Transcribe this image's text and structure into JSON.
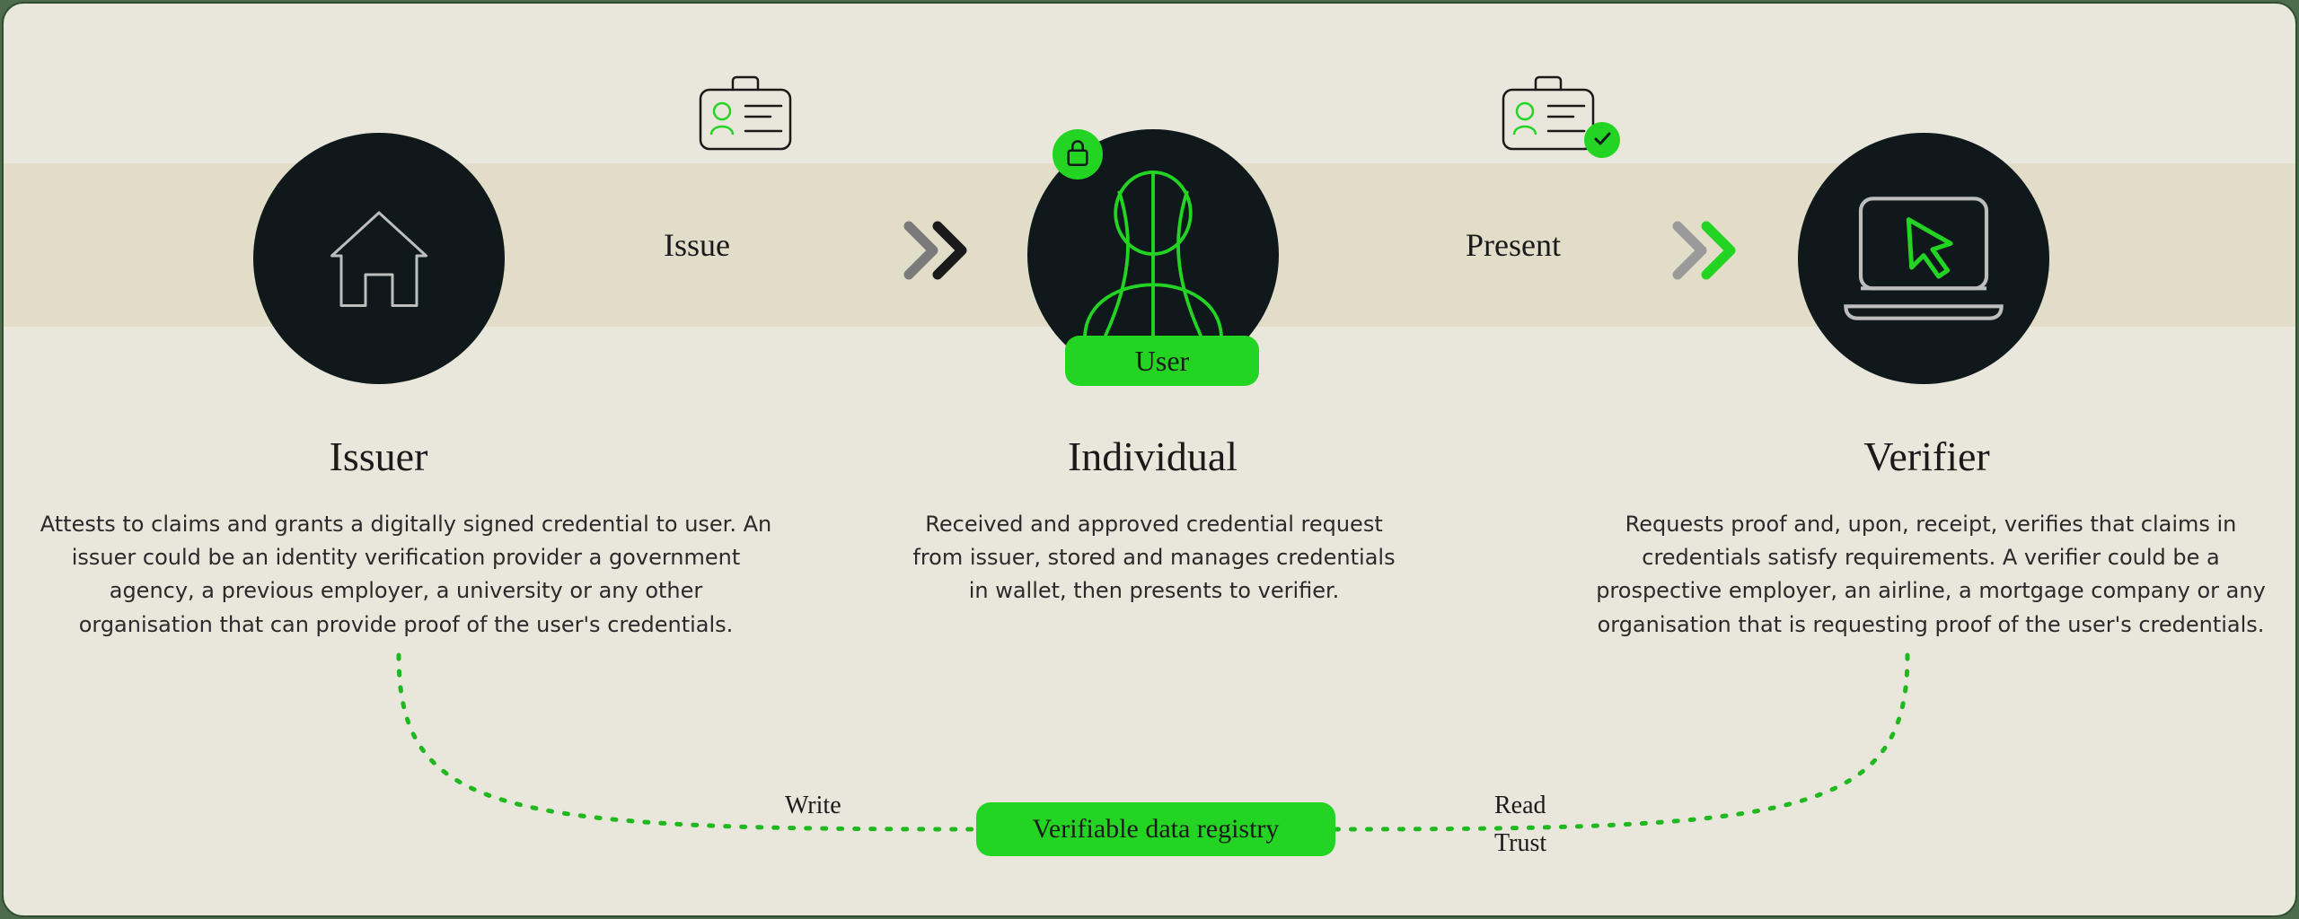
{
  "flow": {
    "issue_label": "Issue",
    "present_label": "Present"
  },
  "roles": {
    "issuer": {
      "title": "Issuer",
      "desc": "Attests to claims and grants a digitally signed credential to user. An issuer could be an identity verification provider a government agency, a previous employer, a university or any other organisation that can provide proof of the user's credentials."
    },
    "individual": {
      "title": "Individual",
      "user_badge": "User",
      "desc": "Received and approved credential request from issuer, stored and manages credentials in wallet, then presents to verifier."
    },
    "verifier": {
      "title": "Verifier",
      "desc": "Requests proof and, upon, receipt, verifies that claims in credentials satisfy requirements. A verifier could be a prospective employer, an airline, a mortgage company or any organisation that is requesting proof of the user's credentials."
    }
  },
  "registry": {
    "label": "Verifiable data registry",
    "write_label": "Write",
    "read_label": "Read",
    "trust_label": "Trust"
  },
  "colors": {
    "accent": "#23d423",
    "node_bg": "#0f191c",
    "canvas_bg": "#e9e6db"
  }
}
